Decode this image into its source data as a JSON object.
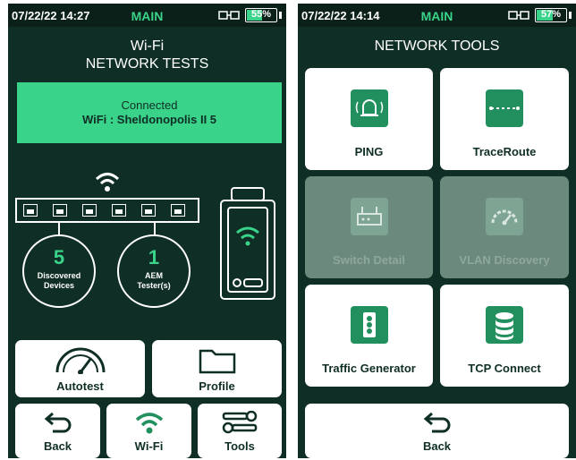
{
  "left": {
    "status": {
      "time": "07/22/22 14:27",
      "mode": "MAIN",
      "battery": "55%",
      "battery_level": 55
    },
    "title_line1": "Wi-Fi",
    "title_line2": "NETWORK TESTS",
    "banner": {
      "line1": "Connected",
      "line2": "WiFi : Sheldonopolis II 5"
    },
    "ports": 6,
    "stats": [
      {
        "value": "5",
        "label_line1": "Discovered",
        "label_line2": "Devices"
      },
      {
        "value": "1",
        "label_line1": "AEM",
        "label_line2": "Tester(s)"
      }
    ],
    "buttons": {
      "autotest": "Autotest",
      "profile": "Profile",
      "back": "Back",
      "wifi": "Wi-Fi",
      "tools": "Tools"
    }
  },
  "right": {
    "status": {
      "time": "07/22/22 14:14",
      "mode": "MAIN",
      "battery": "57%",
      "battery_level": 57
    },
    "title": "NETWORK TOOLS",
    "tiles": [
      {
        "label": "PING",
        "icon": "bell-icon",
        "enabled": true
      },
      {
        "label": "TraceRoute",
        "icon": "traceroute-icon",
        "enabled": true
      },
      {
        "label": "Switch Detail",
        "icon": "switch-icon",
        "enabled": false
      },
      {
        "label": "VLAN Discovery",
        "icon": "gauge-icon",
        "enabled": false
      },
      {
        "label": "Traffic Generator",
        "icon": "traffic-light-icon",
        "enabled": true
      },
      {
        "label": "TCP Connect",
        "icon": "database-icon",
        "enabled": true
      }
    ],
    "back": "Back"
  },
  "colors": {
    "background": "#0f2e25",
    "accent": "#3ad38a",
    "button": "#ffffff",
    "disabled": "#6b8a7d"
  }
}
